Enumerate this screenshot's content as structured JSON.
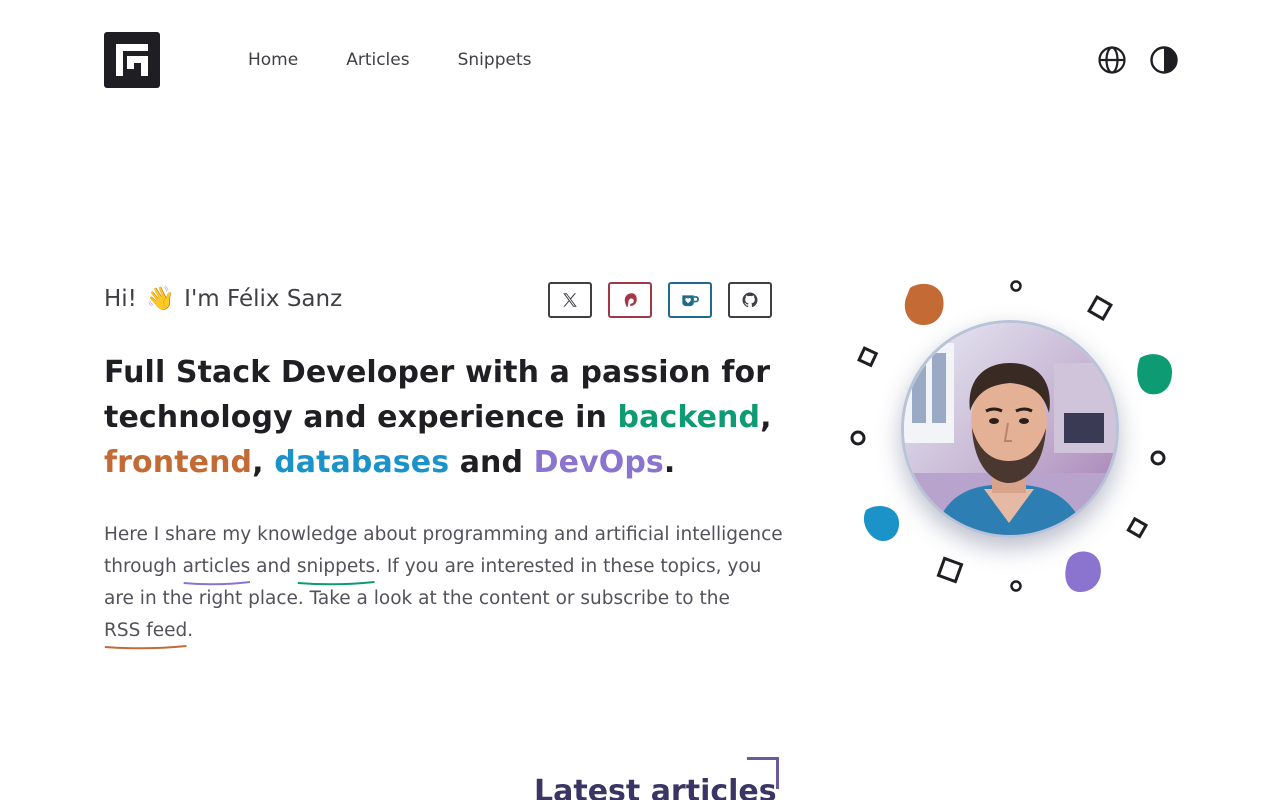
{
  "header": {
    "nav": [
      {
        "label": "Home"
      },
      {
        "label": "Articles"
      },
      {
        "label": "Snippets"
      }
    ]
  },
  "hero": {
    "greeting_prefix": "Hi!",
    "greeting_wave": "👋",
    "greeting_name": "I'm Félix Sanz",
    "headline": {
      "part1": "Full Stack Developer with a passion for technology and experience in ",
      "backend": "backend",
      "comma1": ",",
      "frontend": "frontend",
      "comma2": ", ",
      "databases": "databases",
      "and": " and ",
      "devops": "DevOps",
      "period": "."
    },
    "intro": {
      "text1": "Here I share my knowledge about programming and artificial intelligence through ",
      "articles_link": "articles",
      "text2": " and ",
      "snippets_link": "snippets",
      "text3": ". If you are interested in these topics, you are in the right place. Take a look at the content or subscribe to the ",
      "rss_link": "RSS feed",
      "text4": "."
    }
  },
  "socials": [
    {
      "icon": "x-icon"
    },
    {
      "icon": "patreon-icon"
    },
    {
      "icon": "kofi-icon"
    },
    {
      "icon": "github-icon"
    }
  ],
  "colors": {
    "backend": "#0d9b73",
    "frontend": "#c46a35",
    "databases": "#1b93c8",
    "devops": "#8b74d0"
  },
  "latest": {
    "heading": "Latest articles"
  }
}
